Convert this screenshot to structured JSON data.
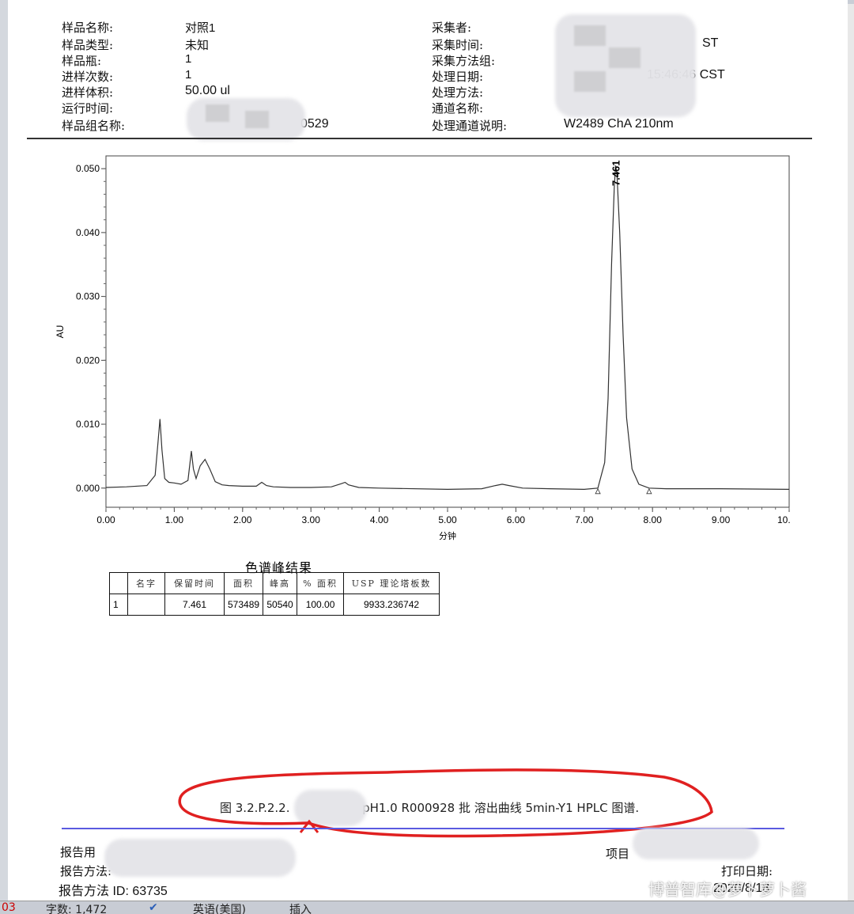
{
  "header": {
    "left": [
      {
        "label": "样品名称:",
        "value": "对照1"
      },
      {
        "label": "样品类型:",
        "value": "未知"
      },
      {
        "label": "样品瓶:",
        "value": "1"
      },
      {
        "label": "进样次数:",
        "value": "1"
      },
      {
        "label": "进样体积:",
        "value": "50.00 ul"
      },
      {
        "label": "运行时间:",
        "value": ""
      },
      {
        "label": "样品组名称:",
        "value": "0529"
      }
    ],
    "right": [
      {
        "label": "采集者:",
        "value": ""
      },
      {
        "label": "采集时间:",
        "value": "ST"
      },
      {
        "label": "采集方法组:",
        "value": ""
      },
      {
        "label": "处理日期:",
        "value": "15:46:46 CST"
      },
      {
        "label": "处理方法:",
        "value": ""
      },
      {
        "label": "通道名称:",
        "value": ""
      },
      {
        "label": "处理通道说明:",
        "value": "W2489 ChA 210nm"
      }
    ]
  },
  "chart_data": {
    "type": "line",
    "ylabel": "AU",
    "xlabel": "分钟",
    "xlim": [
      0.0,
      10.0
    ],
    "ylim": [
      -0.003,
      0.052
    ],
    "x_ticks": [
      "0.00",
      "1.00",
      "2.00",
      "3.00",
      "4.00",
      "5.00",
      "6.00",
      "7.00",
      "8.00",
      "9.00",
      "10.00"
    ],
    "y_ticks": [
      "0.000",
      "0.010",
      "0.020",
      "0.030",
      "0.040",
      "0.050"
    ],
    "peak_label": "7.461",
    "series": [
      {
        "x": [
          0.0,
          0.3,
          0.6,
          0.72,
          0.76,
          0.79,
          0.82,
          0.86,
          0.92,
          1.0,
          1.1,
          1.2,
          1.25,
          1.28,
          1.32,
          1.38,
          1.45,
          1.52,
          1.6,
          1.7,
          1.8,
          2.0,
          2.2,
          2.28,
          2.35,
          2.45,
          2.7,
          3.0,
          3.3,
          3.45,
          3.5,
          3.55,
          3.7,
          4.0,
          5.0,
          5.5,
          5.7,
          5.8,
          5.9,
          6.1,
          6.5,
          7.0,
          7.2,
          7.3,
          7.35,
          7.4,
          7.44,
          7.46,
          7.48,
          7.52,
          7.57,
          7.62,
          7.7,
          7.8,
          7.95,
          8.2,
          9.0,
          10.0
        ],
        "y": [
          0.0001,
          0.0002,
          0.0004,
          0.002,
          0.007,
          0.0108,
          0.006,
          0.0015,
          0.0009,
          0.0008,
          0.0006,
          0.0012,
          0.0058,
          0.003,
          0.0015,
          0.0035,
          0.0045,
          0.003,
          0.001,
          0.0005,
          0.0004,
          0.0003,
          0.0003,
          0.0009,
          0.0004,
          0.0002,
          0.0001,
          0.0001,
          0.0002,
          0.0007,
          0.0009,
          0.0005,
          0.0001,
          0.0,
          -0.0002,
          -0.0001,
          0.0004,
          0.0006,
          0.0004,
          0.0,
          -0.0001,
          -0.0002,
          0.0,
          0.004,
          0.014,
          0.035,
          0.047,
          0.0505,
          0.049,
          0.04,
          0.024,
          0.011,
          0.003,
          0.0006,
          0.0,
          -0.0001,
          -0.0001,
          -0.0002
        ]
      }
    ],
    "baseline_markers": [
      7.2,
      7.95
    ]
  },
  "peak_table": {
    "title": "色谱峰结果",
    "headers": [
      "",
      "名字",
      "保留时间",
      "面积",
      "峰高",
      "% 面积",
      "USP 理论塔板数"
    ],
    "rows": [
      [
        "1",
        "",
        "7.461",
        "573489",
        "50540",
        "100.00",
        "9933.236742"
      ]
    ]
  },
  "caption": {
    "prefix": "图 3.2.P.2.2.",
    "suffix": "pH1.0 R000928 批  溶出曲线  5min-Y1 HPLC 图谱."
  },
  "footer": {
    "report_by": "报告用",
    "report_method": "报告方法:",
    "report_method_id": "报告方法 ID: 63735",
    "project": "项目",
    "print_date_label": "打印日期:",
    "print_date": "2020/8/18"
  },
  "statusbar": {
    "page": "03",
    "wordcount": "字数: 1,472",
    "language": "英语(美国)",
    "mode": "插入"
  },
  "watermark": "博普智库@萝卜萝卜酱",
  "colors": {
    "annotation": "#e02020",
    "divider": "#5a5ae0"
  }
}
